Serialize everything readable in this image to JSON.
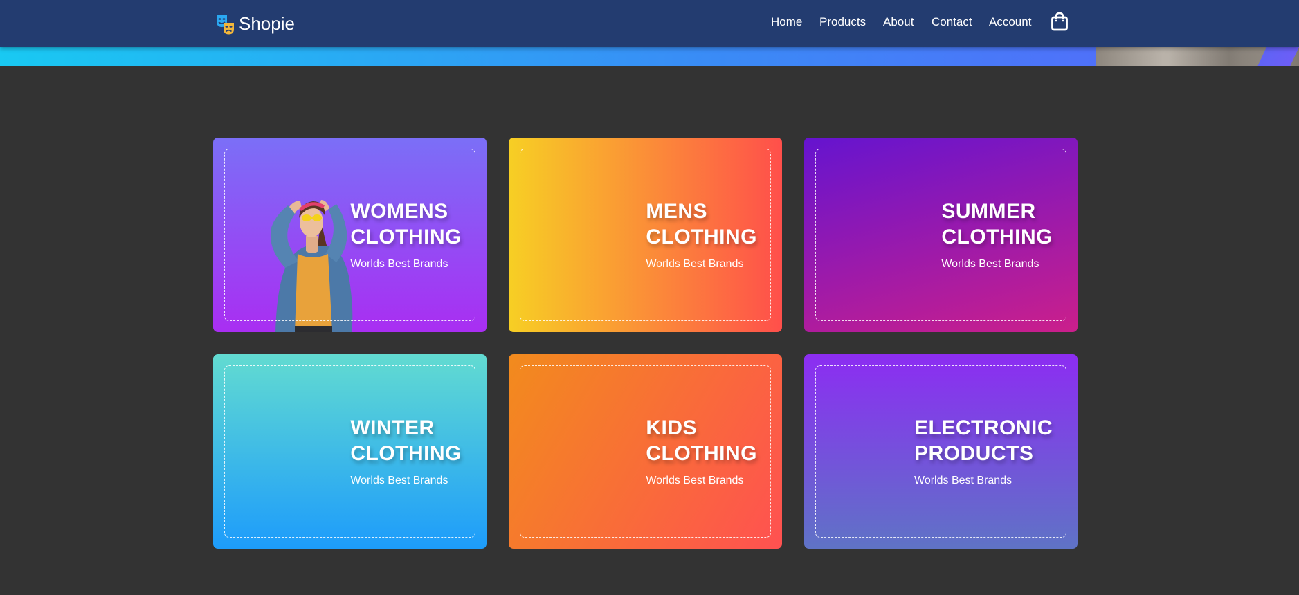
{
  "brand": {
    "name": "Shopie",
    "logo_icon": "theater-masks-icon"
  },
  "nav": {
    "items": [
      {
        "label": "Home"
      },
      {
        "label": "Products"
      },
      {
        "label": "About"
      },
      {
        "label": "Contact"
      },
      {
        "label": "Account"
      }
    ],
    "cart_icon": "shopping-bag-icon"
  },
  "categories": [
    {
      "line1": "WOMENS",
      "line2": "CLOTHING",
      "subtitle": "Worlds Best Brands",
      "gradient": [
        "#7b6ff7",
        "#a92ef2"
      ]
    },
    {
      "line1": "MENS",
      "line2": "CLOTHING",
      "subtitle": "Worlds Best Brands",
      "gradient": [
        "#f7cf24",
        "#ff4f4b"
      ]
    },
    {
      "line1": "SUMMER",
      "line2": "CLOTHING",
      "subtitle": "Worlds Best Brands",
      "gradient": [
        "#6514cf",
        "#cb1f8b"
      ]
    },
    {
      "line1": "WINTER",
      "line2": "CLOTHING",
      "subtitle": "Worlds Best Brands",
      "gradient": [
        "#62dbd1",
        "#1d9cfb"
      ]
    },
    {
      "line1": "KIDS",
      "line2": "CLOTHING",
      "subtitle": "Worlds Best Brands",
      "gradient": [
        "#f28b1d",
        "#ff5151"
      ]
    },
    {
      "line1": "ELECTRONIC",
      "line2": "PRODUCTS",
      "subtitle": "Worlds Best Brands",
      "gradient": [
        "#8c2df2",
        "#5f73c6"
      ]
    }
  ]
}
